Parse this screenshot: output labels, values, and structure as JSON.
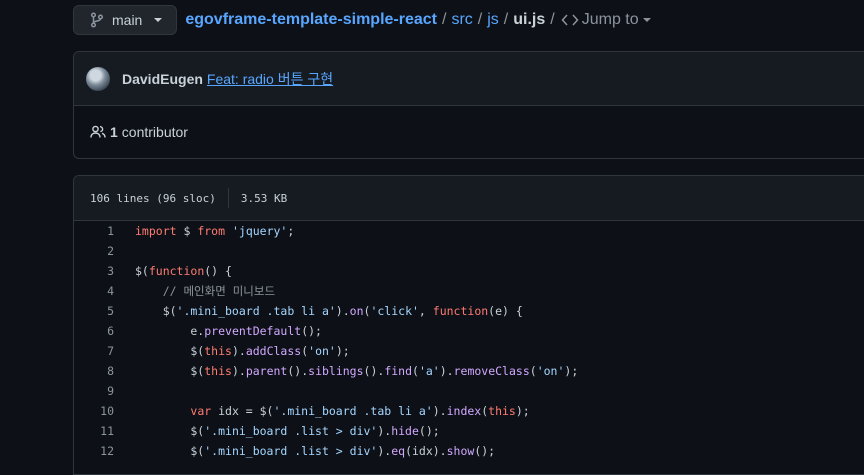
{
  "branch": {
    "name": "main"
  },
  "breadcrumb": {
    "repo": "egovframe-template-simple-react",
    "sep": "/",
    "dir1": "src",
    "dir2": "js",
    "file": "ui.js",
    "jump_label": "Jump to"
  },
  "commit": {
    "author": "DavidEugen",
    "message": "Feat: radio 버튼 구현"
  },
  "contributors": {
    "count": "1",
    "label": "contributor"
  },
  "file_info": {
    "lines": "106 lines (96 sloc)",
    "size": "3.53 KB"
  },
  "code_lines": [
    {
      "n": "1",
      "t": [
        [
          "kw",
          "import"
        ],
        [
          "src",
          " $ "
        ],
        [
          "kw",
          "from"
        ],
        [
          "src",
          " "
        ],
        [
          "str",
          "'jquery'"
        ],
        [
          "src",
          ";"
        ]
      ]
    },
    {
      "n": "2",
      "t": []
    },
    {
      "n": "3",
      "t": [
        [
          "src",
          "$("
        ],
        [
          "kw",
          "function"
        ],
        [
          "src",
          "() {"
        ]
      ]
    },
    {
      "n": "4",
      "t": [
        [
          "cm",
          "    // 메인화면 미니보드"
        ]
      ]
    },
    {
      "n": "5",
      "t": [
        [
          "src",
          "    $("
        ],
        [
          "str",
          "'.mini_board .tab li a'"
        ],
        [
          "src",
          "). "
        ],
        [
          "fn",
          "on"
        ],
        [
          "src",
          "("
        ],
        [
          "str",
          "'click'"
        ],
        [
          "src",
          ", "
        ],
        [
          "kw",
          "function"
        ],
        [
          "src",
          "(e) {"
        ]
      ]
    },
    {
      "n": "6",
      "t": [
        [
          "src",
          "        e."
        ],
        [
          "fn",
          "preventDefault"
        ],
        [
          "src",
          "();"
        ]
      ]
    },
    {
      "n": "7",
      "t": [
        [
          "src",
          "        $("
        ],
        [
          "kw",
          "this"
        ],
        [
          "src",
          "). "
        ],
        [
          "fn",
          "addClass"
        ],
        [
          "src",
          "("
        ],
        [
          "str",
          "'on'"
        ],
        [
          "src",
          ");"
        ]
      ]
    },
    {
      "n": "8",
      "t": [
        [
          "src",
          "        $("
        ],
        [
          "kw",
          "this"
        ],
        [
          "src",
          "). "
        ],
        [
          "fn",
          "parent"
        ],
        [
          "src",
          "(). "
        ],
        [
          "fn",
          "siblings"
        ],
        [
          "src",
          "(). "
        ],
        [
          "fn",
          "find"
        ],
        [
          "src",
          "("
        ],
        [
          "str",
          "'a'"
        ],
        [
          "src",
          "). "
        ],
        [
          "fn",
          "removeClass"
        ],
        [
          "src",
          "("
        ],
        [
          "str",
          "'on'"
        ],
        [
          "src",
          ");"
        ]
      ]
    },
    {
      "n": "9",
      "t": []
    },
    {
      "n": "10",
      "t": [
        [
          "src",
          "        "
        ],
        [
          "kw",
          "var"
        ],
        [
          "src",
          " idx = $("
        ],
        [
          "str",
          "'.mini_board .tab li a'"
        ],
        [
          "src",
          "). "
        ],
        [
          "fn",
          "index"
        ],
        [
          "src",
          "("
        ],
        [
          "kw",
          "this"
        ],
        [
          "src",
          ");"
        ]
      ]
    },
    {
      "n": "11",
      "t": [
        [
          "src",
          "        $("
        ],
        [
          "str",
          "'.mini_board .list > div'"
        ],
        [
          "src",
          "). "
        ],
        [
          "fn",
          "hide"
        ],
        [
          "src",
          "();"
        ]
      ]
    },
    {
      "n": "12",
      "t": [
        [
          "src",
          "        $("
        ],
        [
          "str",
          "'.mini_board .list > div'"
        ],
        [
          "src",
          "). "
        ],
        [
          "fn",
          "eq"
        ],
        [
          "src",
          "(idx). "
        ],
        [
          "fn",
          "show"
        ],
        [
          "src",
          "();"
        ]
      ]
    }
  ],
  "colors": {
    "background": "#0d1117",
    "link": "#58a6ff",
    "keyword": "#ff7b72",
    "string": "#a5d6ff",
    "function": "#d2a8ff",
    "comment": "#8b949e"
  }
}
